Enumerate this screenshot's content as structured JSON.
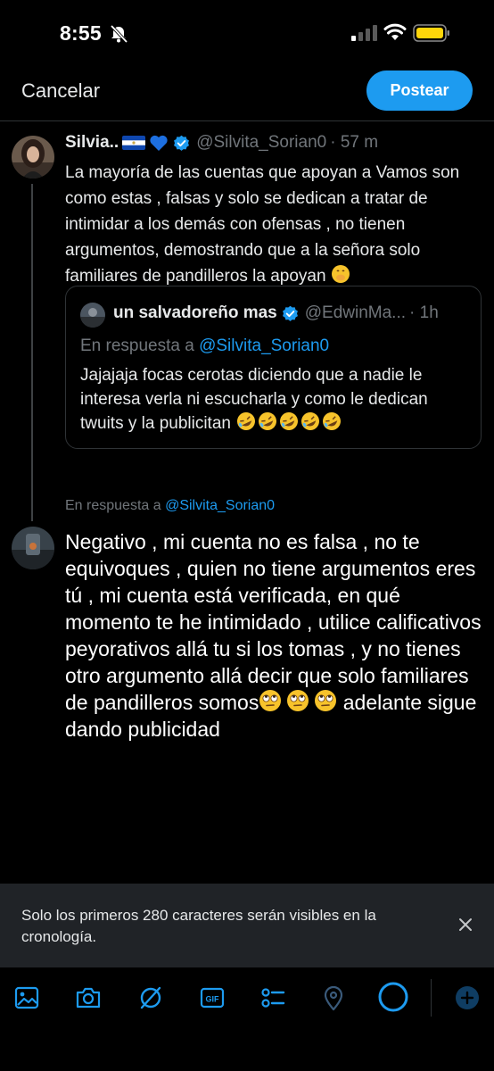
{
  "status_bar": {
    "time": "8:55"
  },
  "header": {
    "cancel_label": "Cancelar",
    "post_label": "Postear"
  },
  "original_tweet": {
    "name": "Silvia..",
    "handle": "@Silvita_Sorian0",
    "time": "· 57 m",
    "text": "La mayoría de las cuentas que apoyan a Vamos son como estas , falsas y solo se dedican a  tratar de intimidar a los demás con ofensas , no tienen argumentos, demostrando que a la señora solo familiares de pandilleros la apoyan"
  },
  "quoted_tweet": {
    "name": "un salvadoreño mas",
    "handle": "@EdwinMa...",
    "time": "· 1h",
    "reply_prefix": "En respuesta a",
    "reply_mention": "@Silvita_Sorian0",
    "text": "Jajajaja focas cerotas diciendo que a nadie le interesa verla ni escucharla y como le dedican twuits y la publicitan"
  },
  "composer": {
    "reply_prefix": "En respuesta a",
    "reply_mention": "@Silvita_Sorian0",
    "text_part1": "Negativo , mi cuenta no es falsa , no te equivoques , quien no tiene argumentos eres tú , mi cuenta está verificada, en qué momento te he intimidado , utilice calificativos peyorativos allá tu si los tomas , y no tienes otro argumento allá decir que solo familiares de pandilleros somos",
    "text_part2": " adelante sigue dando publicidad"
  },
  "toast": {
    "text": "Solo los primeros 280 caracteres serán visibles en la cronología."
  },
  "toolbar": {
    "gif_label": "GIF",
    "icons": [
      "image-icon",
      "camera-icon",
      "grok-icon",
      "gif-icon",
      "poll-icon",
      "location-icon",
      "character-counter",
      "add-post-icon"
    ]
  },
  "colors": {
    "accent": "#1d9bf0",
    "background": "#000000",
    "muted": "#71767b",
    "toast_bg": "#202327"
  }
}
